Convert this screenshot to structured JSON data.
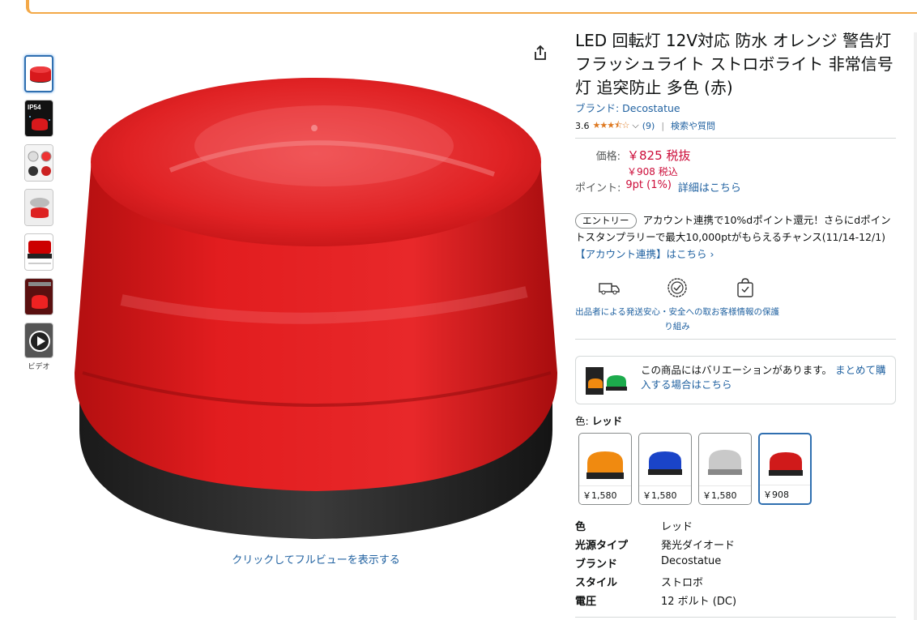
{
  "product": {
    "title": "LED 回転灯 12V対応 防水 オレンジ 警告灯 フラッシュライト ストロボライト 非常信号灯 追突防止 多色 (赤)",
    "brand_link": "ブランド: Decostatue",
    "rating_value": "3.6",
    "rating_stars": 3.5,
    "rating_count": "(9)",
    "search_qa": "検索や質問",
    "fullview_link": "クリックしてフルビューを表示する"
  },
  "thumbnails": {
    "video_label": "ビデオ",
    "badge_text": "IP54"
  },
  "price": {
    "label": "価格:",
    "main": "￥825 税抜",
    "tax_included": "￥908 税込",
    "points_label": "ポイント:",
    "points_value": "9pt  (1%)",
    "points_link": "詳細はこちら"
  },
  "promo": {
    "badge": "エントリー",
    "text": "アカウント連携で10%dポイント還元！さらにdポイントスタンプラリーで最大10,000ptがもらえるチャンス(11/14-12/1)",
    "link": "【アカウント連携】はこちら ›"
  },
  "trust": [
    {
      "label": "出品者による発送",
      "icon": "truck-icon"
    },
    {
      "label": "安心・安全への取り組み",
      "icon": "badge-check-icon"
    },
    {
      "label": "お客様情報の保護",
      "icon": "secure-bag-icon"
    }
  ],
  "variation": {
    "text": "この商品にはバリエーションがあります。",
    "link": "まとめて購入する場合はこちら"
  },
  "color": {
    "label": "色: ",
    "selected": "レッド",
    "swatches": [
      {
        "price": "￥1,580",
        "color": "#f08a10"
      },
      {
        "price": "￥1,580",
        "color": "#1a44c8"
      },
      {
        "price": "￥1,580",
        "color": "#c9c9c9"
      },
      {
        "price": "￥908",
        "color": "#d01a1a"
      }
    ]
  },
  "specs": [
    {
      "key": "色",
      "value": "レッド"
    },
    {
      "key": "光源タイプ",
      "value": "発光ダイオード"
    },
    {
      "key": "ブランド",
      "value": "Decostatue"
    },
    {
      "key": "スタイル",
      "value": "ストロボ"
    },
    {
      "key": "電圧",
      "value": "12 ボルト (DC)"
    }
  ],
  "colors": {
    "link": "#2162a1",
    "price": "#cc0c39",
    "star": "#de7921",
    "selected_border": "#2f6fb0"
  }
}
